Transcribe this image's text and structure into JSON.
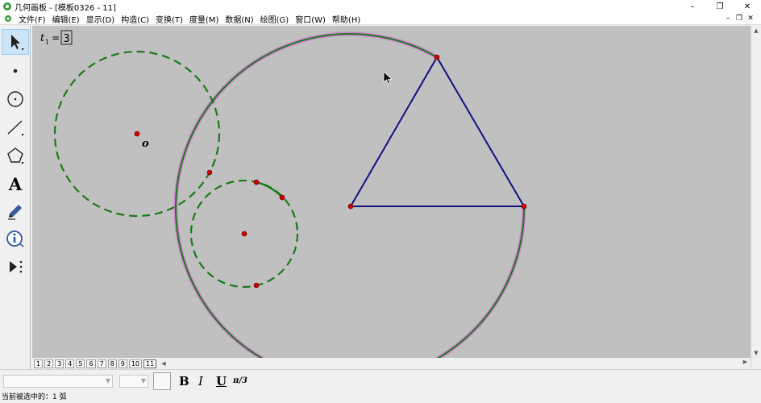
{
  "window": {
    "title": "几何画板 - [模板0326 - 11]",
    "controls": [
      "–",
      "❐",
      "✕"
    ]
  },
  "menubar": {
    "items": [
      "文件(F)",
      "编辑(E)",
      "显示(D)",
      "构造(C)",
      "变换(T)",
      "度量(M)",
      "数据(N)",
      "绘图(G)",
      "窗口(W)",
      "帮助(H)"
    ],
    "doc_controls": [
      "–",
      "❐",
      "✕"
    ]
  },
  "toolbox": {
    "tools": [
      "arrow-select",
      "point",
      "compass",
      "straightedge",
      "polygon",
      "text",
      "marker",
      "information",
      "custom"
    ],
    "text_tool_label": "A"
  },
  "canvas": {
    "parameter_name": "t",
    "parameter_subscript": "1",
    "parameter_equals": "=",
    "parameter_value": "3",
    "point_label": "o",
    "colors": {
      "background": "#c0c0c0",
      "dashed_circle": "#1a7a1a",
      "arc": "#1a7a1a",
      "arc_highlight": "#d080d0",
      "triangle": "#101080",
      "point_fill": "#d00000"
    }
  },
  "pagebar": {
    "tabs": [
      "1",
      "2",
      "3",
      "4",
      "5",
      "6",
      "7",
      "8",
      "9",
      "10",
      "11"
    ],
    "current": "11"
  },
  "formatbar": {
    "bold": "B",
    "italic": "I",
    "underline": "U",
    "math_format": "π/3"
  },
  "statusbar": {
    "text": "当前被选中的：1 弧"
  }
}
